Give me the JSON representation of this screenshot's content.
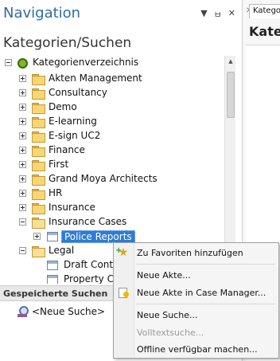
{
  "navigation": {
    "title": "Navigation",
    "controls": {
      "dropdown": "▼",
      "pin": "ㅂ",
      "close": "✕"
    }
  },
  "section_title": "Kategorien/Suchen",
  "tree": {
    "root": "Kategorienverzeichnis",
    "items": [
      {
        "label": "Akten Management",
        "expander": "plus"
      },
      {
        "label": "Consultancy",
        "expander": "plus"
      },
      {
        "label": "Demo",
        "expander": "plus"
      },
      {
        "label": "E-learning",
        "expander": "plus"
      },
      {
        "label": "E-sign UC2",
        "expander": "plus"
      },
      {
        "label": "Finance",
        "expander": "plus"
      },
      {
        "label": "First",
        "expander": "plus"
      },
      {
        "label": "Grand Moya Architects",
        "expander": "plus"
      },
      {
        "label": "HR",
        "expander": "plus"
      },
      {
        "label": "Insurance",
        "expander": "plus"
      },
      {
        "label": "Insurance Cases",
        "expander": "minus"
      }
    ],
    "selected_child": "Police Reports",
    "legal": {
      "label": "Legal",
      "expander": "minus"
    },
    "legal_children": [
      "Draft Contr",
      "Property Co"
    ]
  },
  "saved_searches": {
    "header": "Gespeicherte Suchen",
    "new_search": "<Neue Suche>"
  },
  "right_pane": {
    "close_glyph": "✕",
    "tab_label": "Katego",
    "heading": "Katego"
  },
  "context_menu": {
    "items": [
      {
        "label": "Zu Favoriten hinzufügen",
        "enabled": true,
        "icon": "add-favorite-icon"
      },
      {
        "label": "Neue Akte...",
        "enabled": true
      },
      {
        "label": "Neue Akte in Case Manager...",
        "enabled": true,
        "icon": "case-manager-icon"
      },
      {
        "label": "Neue Suche...",
        "enabled": true
      },
      {
        "label": "Volltextsuche...",
        "enabled": false
      },
      {
        "label": "Offline verfügbar machen...",
        "enabled": true
      }
    ]
  },
  "colors": {
    "title_blue": "#2e6da4",
    "selection_blue": "#2f7bd6",
    "folder_yellow": "#f6d676"
  }
}
